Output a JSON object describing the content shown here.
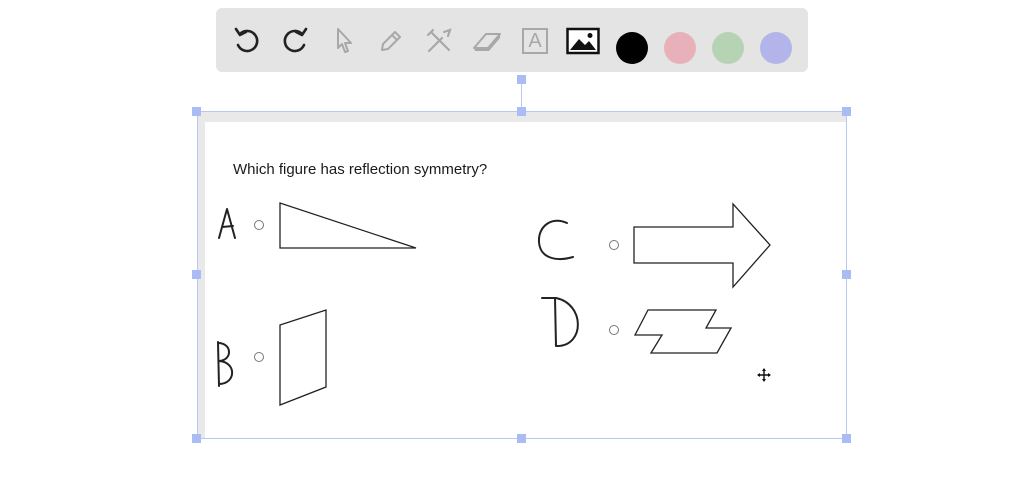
{
  "toolbar": {
    "tools": [
      {
        "name": "undo-icon",
        "enabled": true
      },
      {
        "name": "redo-icon",
        "enabled": true
      },
      {
        "name": "pointer-icon",
        "enabled": false
      },
      {
        "name": "pencil-icon",
        "enabled": false
      },
      {
        "name": "tools-icon",
        "enabled": false
      },
      {
        "name": "eraser-icon",
        "enabled": false
      },
      {
        "name": "text-icon",
        "enabled": false
      },
      {
        "name": "image-icon",
        "enabled": true
      }
    ],
    "text_tool_glyph": "A",
    "colors": [
      "#000000",
      "#e8b0b8",
      "#b6d4b4",
      "#b3b5ea"
    ]
  },
  "worksheet": {
    "question": "Which figure has reflection symmetry?"
  }
}
